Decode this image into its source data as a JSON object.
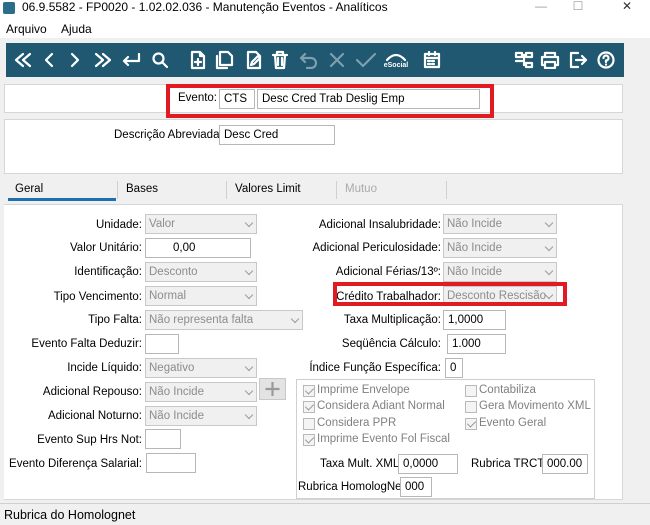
{
  "window": {
    "title": "06.9.5582 - FP0020 - 1.02.02.036 - Manutenção Eventos - Analíticos",
    "minimize": "—",
    "maximize": "☐",
    "close": "✕"
  },
  "menu": {
    "arquivo": "Arquivo",
    "ajuda": "Ajuda"
  },
  "colors": {
    "toolbar_bg": "#1f5870",
    "highlight": "#e01b24",
    "tab_active": "#1e6fb0"
  },
  "evento": {
    "label": "Evento:",
    "code": "CTS",
    "description": "Desc Cred Trab Deslig Emp"
  },
  "descricao_abreviada": {
    "label": "Descrição Abreviada:",
    "value": "Desc Cred"
  },
  "tabs": [
    {
      "label": "Geral",
      "active": true
    },
    {
      "label": "Bases"
    },
    {
      "label": "Valores Limit"
    },
    {
      "label": "Mutuo",
      "disabled": true
    }
  ],
  "left": {
    "unidade": {
      "label": "Unidade:",
      "value": "Valor"
    },
    "valor_unitario": {
      "label": "Valor Unitário:",
      "value": "0,00"
    },
    "identificacao": {
      "label": "Identificação:",
      "value": "Desconto"
    },
    "tipo_vencimento": {
      "label": "Tipo Vencimento:",
      "value": "Normal"
    },
    "tipo_falta": {
      "label": "Tipo Falta:",
      "value": "Não representa falta"
    },
    "evento_falta_deduzir": {
      "label": "Evento Falta Deduzir:",
      "value": ""
    },
    "incide_liquido": {
      "label": "Incide Líquido:",
      "value": "Negativo"
    },
    "adicional_repouso": {
      "label": "Adicional Repouso:",
      "value": "Não Incide"
    },
    "adicional_noturno": {
      "label": "Adicional Noturno:",
      "value": "Não Incide"
    },
    "evento_sup_hrs_not": {
      "label": "Evento Sup Hrs Not:",
      "value": ""
    },
    "evento_diferenca_salarial": {
      "label": "Evento Diferença Salarial:",
      "value": ""
    }
  },
  "right": {
    "adicional_insalubridade": {
      "label": "Adicional Insalubridade:",
      "value": "Não Incide"
    },
    "adicional_periculosidade": {
      "label": "Adicional Periculosidade:",
      "value": "Não Incide"
    },
    "adicional_ferias": {
      "label": "Adicional Férias/13º:",
      "value": "Não Incide"
    },
    "credito_trabalhador": {
      "label": "Crédito Trabalhador:",
      "value": "Desconto Rescisão"
    },
    "taxa_multiplicacao": {
      "label": "Taxa Multiplicação:",
      "value": "1,0000"
    },
    "sequencia_calculo": {
      "label": "Seqüência Cálculo:",
      "value": "1.000"
    },
    "indice_funcao_especifica": {
      "label": "Índice Função Específica:",
      "value": "0"
    }
  },
  "checks": {
    "imprime_envelope": {
      "label": "Imprime Envelope",
      "checked": true
    },
    "contabiliza": {
      "label": "Contabiliza",
      "checked": false
    },
    "considera_adiant_normal": {
      "label": "Considera Adiant Normal",
      "checked": true
    },
    "gera_movimento_xml": {
      "label": "Gera Movimento XML",
      "checked": false
    },
    "considera_ppr": {
      "label": "Considera PPR",
      "checked": false
    },
    "evento_geral": {
      "label": "Evento Geral",
      "checked": true
    },
    "imprime_evento_fol_fiscal": {
      "label": "Imprime Evento Fol Fiscal",
      "checked": true
    }
  },
  "taxa_mult_xml": {
    "label": "Taxa Mult. XML:",
    "value": "0,0000"
  },
  "rubrica_trct": {
    "label": "Rubrica TRCT:",
    "value": "000.00"
  },
  "rubrica_homolognet": {
    "label": "Rubrica HomologNet:",
    "value": "000"
  },
  "status_bar": "Rubrica do Homolognet",
  "toolbar": {
    "esocial_label": "eSocial"
  }
}
